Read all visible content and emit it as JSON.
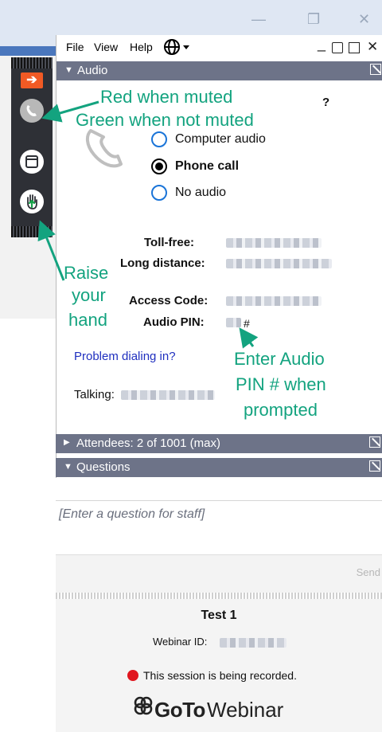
{
  "menu": {
    "file": "File",
    "view": "View",
    "help": "Help"
  },
  "sections": {
    "audio": "Audio",
    "attendees": "Attendees: 2 of 1001 (max)",
    "questions": "Questions"
  },
  "audio": {
    "help": "?",
    "options": [
      {
        "label": "Computer audio",
        "selected": false
      },
      {
        "label": "Phone call",
        "selected": true
      },
      {
        "label": "No audio",
        "selected": false
      }
    ],
    "toll_free_label": "Toll-free:",
    "long_distance_label": "Long distance:",
    "access_code_label": "Access Code:",
    "audio_pin_label": "Audio PIN:",
    "pin_suffix": "#",
    "problem_link": "Problem dialing in?",
    "talking_label": "Talking:"
  },
  "questions": {
    "placeholder": "[Enter a question for staff]",
    "send": "Send"
  },
  "footer": {
    "title": "Test 1",
    "webinar_id_label": "Webinar ID:",
    "recording_text": "This session is being recorded.",
    "logo_goto": "GoTo",
    "logo_webinar": "Webinar"
  },
  "annotations": {
    "muted_1": "Red when muted",
    "muted_2": "Green when not muted",
    "raise_1": "Raise",
    "raise_2": "your",
    "raise_3": "hand",
    "pin_1": "Enter Audio",
    "pin_2": "PIN # when",
    "pin_3": "prompted"
  },
  "colors": {
    "section_bar": "#6d7388",
    "annotation": "#13a37f",
    "toolbar": "#2e3036",
    "raise_arrow": "#f15a24",
    "recording": "#e0161f",
    "link": "#1f2fbf"
  }
}
